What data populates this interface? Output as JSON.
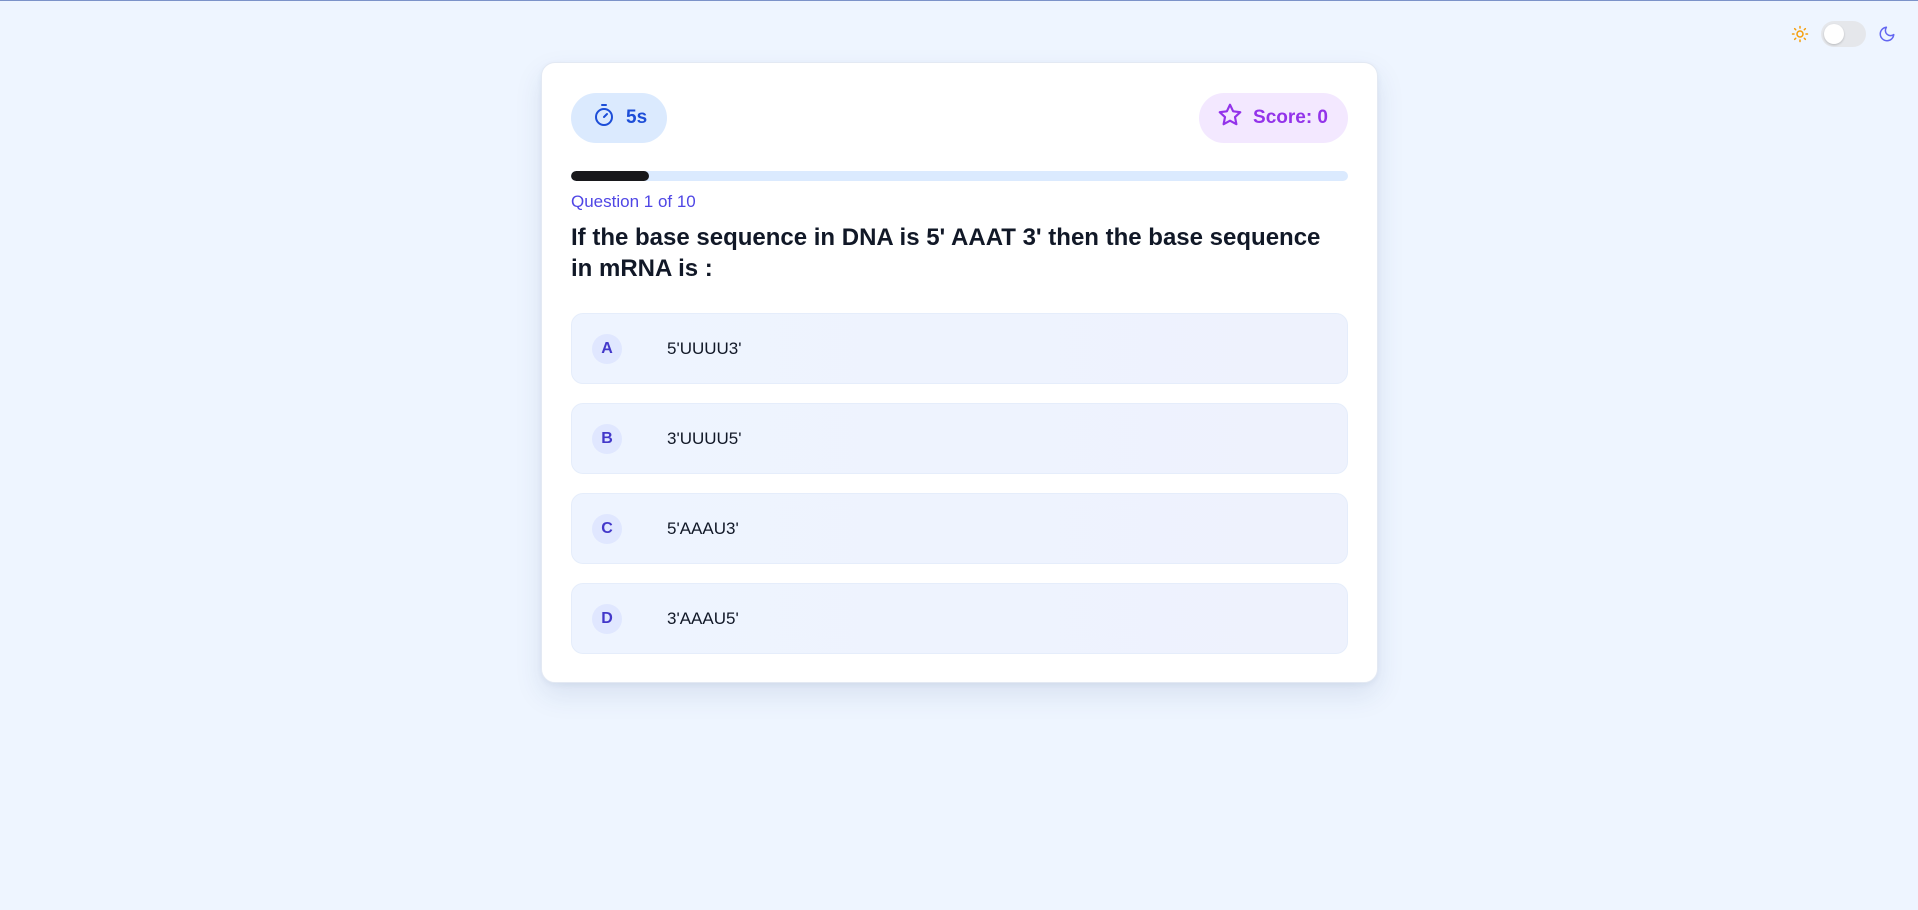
{
  "theme": {
    "sun_icon": "sun-icon",
    "moon_icon": "moon-icon",
    "dark_mode_enabled": false
  },
  "quiz": {
    "timer": {
      "icon": "timer-icon",
      "label": "5s"
    },
    "score": {
      "icon": "star-icon",
      "label": "Score: 0"
    },
    "progress_fraction": 0.1,
    "question_count": "Question 1 of 10",
    "question": "If the base sequence in DNA is 5' AAAT 3' then the base sequence in mRNA is :",
    "options": [
      {
        "letter": "A",
        "text": "5'UUUU3'"
      },
      {
        "letter": "B",
        "text": "3'UUUU5'"
      },
      {
        "letter": "C",
        "text": "5'AAAU3'"
      },
      {
        "letter": "D",
        "text": "3'AAAU5'"
      }
    ]
  },
  "colors": {
    "page_background": "#eef5ff",
    "timer_accent": "#1d4ed8",
    "score_accent": "#9333ea",
    "question_count": "#4f46e5",
    "sun": "#f59e0b",
    "moon": "#6366f1"
  }
}
